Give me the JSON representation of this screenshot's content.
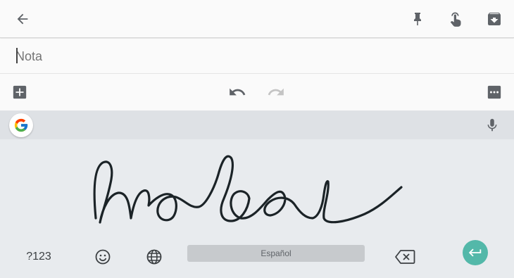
{
  "toolbar": {
    "back_icon": "arrow-back-icon",
    "pin_icon": "pin-icon",
    "reminder_icon": "reminder-hand-icon",
    "archive_icon": "archive-icon"
  },
  "note": {
    "placeholder": "Nota",
    "value": ""
  },
  "editbar": {
    "add_icon": "add-box-icon",
    "undo_icon": "undo-icon",
    "redo_icon": "redo-icon",
    "more_icon": "more-horiz-icon"
  },
  "keyboard": {
    "google_icon": "google-g-icon",
    "mic_icon": "mic-icon",
    "handwriting_ink_color": "#1b2327",
    "num_key_label": "?123",
    "space_label": "Español",
    "enter_color": "#53b8a9"
  }
}
